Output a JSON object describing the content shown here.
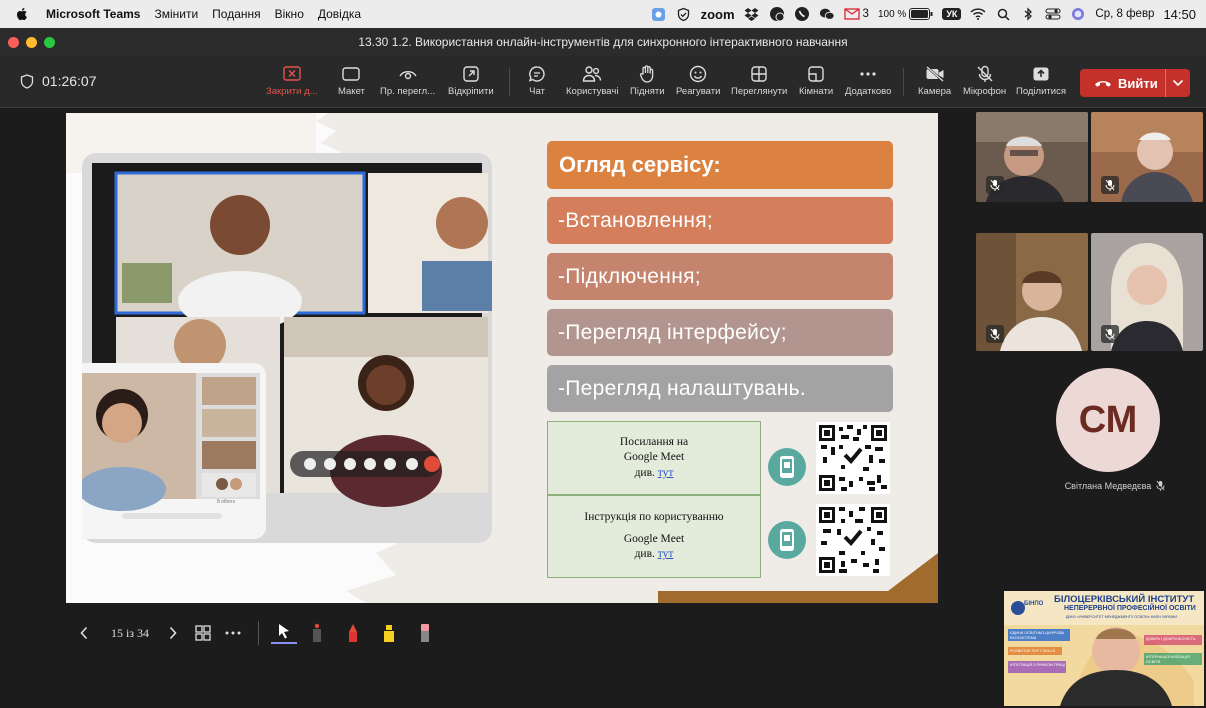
{
  "menubar": {
    "app_name": "Microsoft Teams",
    "menus": [
      "Змінити",
      "Подання",
      "Вікно",
      "Довідка"
    ],
    "zoom_label": "zoom",
    "mail_count": "3",
    "battery": "100 %",
    "input_lang": "УК",
    "datetime": "Ср, 8 февр",
    "time": "14:50"
  },
  "window": {
    "title": "13.30 1.2. Використання онлайн-інструментів для синхронного інтерактивного навчання"
  },
  "toolbar": {
    "timer": "01:26:07",
    "buttons": [
      {
        "label": "Закрити д...",
        "icon": "close-share-icon"
      },
      {
        "label": "Макет",
        "icon": "layout-icon"
      },
      {
        "label": "Пр. перегл...",
        "icon": "eye-icon"
      },
      {
        "label": "Відкріпити",
        "icon": "popout-icon"
      },
      {
        "label": "Чат",
        "icon": "chat-icon"
      },
      {
        "label": "Користувачі",
        "icon": "people-icon"
      },
      {
        "label": "Підняти",
        "icon": "raise-hand-icon"
      },
      {
        "label": "Реагувати",
        "icon": "smile-icon"
      },
      {
        "label": "Переглянути",
        "icon": "view-icon"
      },
      {
        "label": "Кімнати",
        "icon": "rooms-icon"
      },
      {
        "label": "Додатково",
        "icon": "more-icon"
      },
      {
        "label": "Камера",
        "icon": "camera-off-icon"
      },
      {
        "label": "Мікрофон",
        "icon": "mic-off-icon"
      },
      {
        "label": "Поділитися",
        "icon": "share-icon"
      }
    ],
    "leave_label": "Вийти",
    "accent_color": "#c4312b"
  },
  "slide": {
    "heading": "Огляд сервісу:",
    "items": [
      "-Встановлення;",
      "-Підключення;",
      "-Перегляд інтерфейсу;",
      "-Перегляд налаштувань."
    ],
    "item_colors": [
      "#d47e5c",
      "#c4846e",
      "#b2958f",
      "#a3a3a3"
    ],
    "heading_color": "#dc8240",
    "link1": {
      "line1": "Посилання на",
      "line2": "Google Meet",
      "prefix": "див. ",
      "link": "тут"
    },
    "link2": {
      "line1": "Інструкція по користуванню",
      "line2": "Google Meet",
      "prefix": "див. ",
      "link": "тут"
    },
    "device_side_label": "8 others"
  },
  "slidenav": {
    "page": "15 із 34"
  },
  "participants": {
    "avatar_initials": "СМ",
    "avatar_name": "Світлана Медведєва"
  },
  "selfview_banner": {
    "logo": "БІНПО",
    "title_line1": "БІЛОЦЕРКІВСЬКИЙ ІНСТИТУТ",
    "title_line2": "НЕПЕРЕРВНОЇ ПРОФЕСІЙНОЇ ОСВІТИ",
    "subtitle": "ДВНЗ «УНІВЕРСИТЕТ МЕНЕДЖМЕНТУ ОСВІТИ» НАПН УКРАЇНИ",
    "tag1": "ЄДИНА ОСВІТНЬО-ЦИФРОВА ЕКОСИСТЕМА",
    "tag2": "РОЗВИТОК SOFT SKILLS",
    "tag3": "ІНТЕГРАЦІЯ З РИНКОМ ПРАЦІ",
    "tag4": "ДОВІРА І ДОБРОЧЕСНІСТЬ",
    "tag5": "ІНТЕРНАЦІОНАЛІЗАЦІЯ ОСВІТИ"
  }
}
